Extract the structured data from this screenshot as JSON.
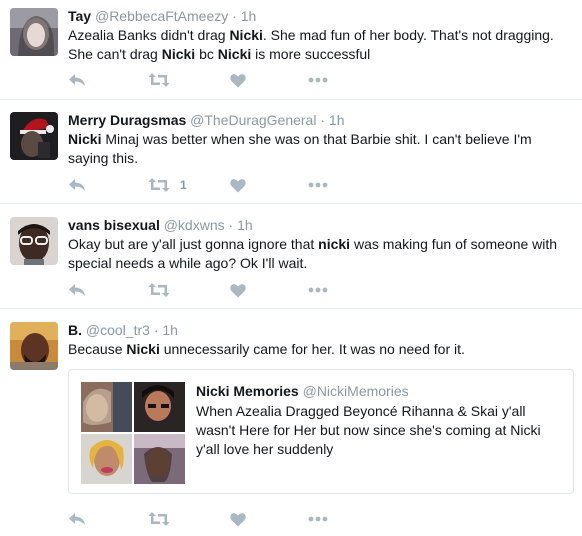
{
  "tweets": [
    {
      "name": "Tay",
      "handle": "@RebbecaFtAmeezy",
      "time": "1h",
      "text": [
        {
          "t": "Azealia Banks didn't drag "
        },
        {
          "t": "Nicki",
          "b": true
        },
        {
          "t": ". She mad fun of her body. That's not dragging. She can't drag "
        },
        {
          "t": "Nicki",
          "b": true
        },
        {
          "t": " bc "
        },
        {
          "t": "Nicki",
          "b": true
        },
        {
          "t": " is more successful"
        }
      ],
      "retweet_count": ""
    },
    {
      "name": "Merry Duragsmas",
      "handle": "@TheDuragGeneral",
      "time": "1h",
      "text": [
        {
          "t": "Nicki",
          "b": true
        },
        {
          "t": " Minaj was better when she was on that Barbie shit. I can't believe I'm saying this."
        }
      ],
      "retweet_count": "1"
    },
    {
      "name": "vans bisexual",
      "handle": "@kdxwns",
      "time": "1h",
      "text": [
        {
          "t": "Okay but are y'all just gonna ignore that "
        },
        {
          "t": "nicki",
          "b": true
        },
        {
          "t": " was making fun of someone with special needs a while ago? Ok I'll wait."
        }
      ],
      "retweet_count": ""
    },
    {
      "name": "B.",
      "handle": "@cool_tr3",
      "time": "1h",
      "text": [
        {
          "t": "Because "
        },
        {
          "t": "Nicki",
          "b": true
        },
        {
          "t": " unnecessarily came for her. It was no need for it."
        }
      ],
      "retweet_count": "",
      "quote": {
        "name": "Nicki Memories",
        "handle": "@NickiMemories",
        "text": "When Azealia Dragged Beyoncé Rihanna & Skai y'all wasn't Here for Her but now since she's coming at Nicki y'all love her suddenly"
      }
    }
  ],
  "separator": "·",
  "colors": {
    "icon": "#aab8c2",
    "muted": "#8899a6",
    "border": "#e6ecf0"
  },
  "icons": [
    "reply-icon",
    "retweet-icon",
    "like-icon",
    "more-icon"
  ]
}
